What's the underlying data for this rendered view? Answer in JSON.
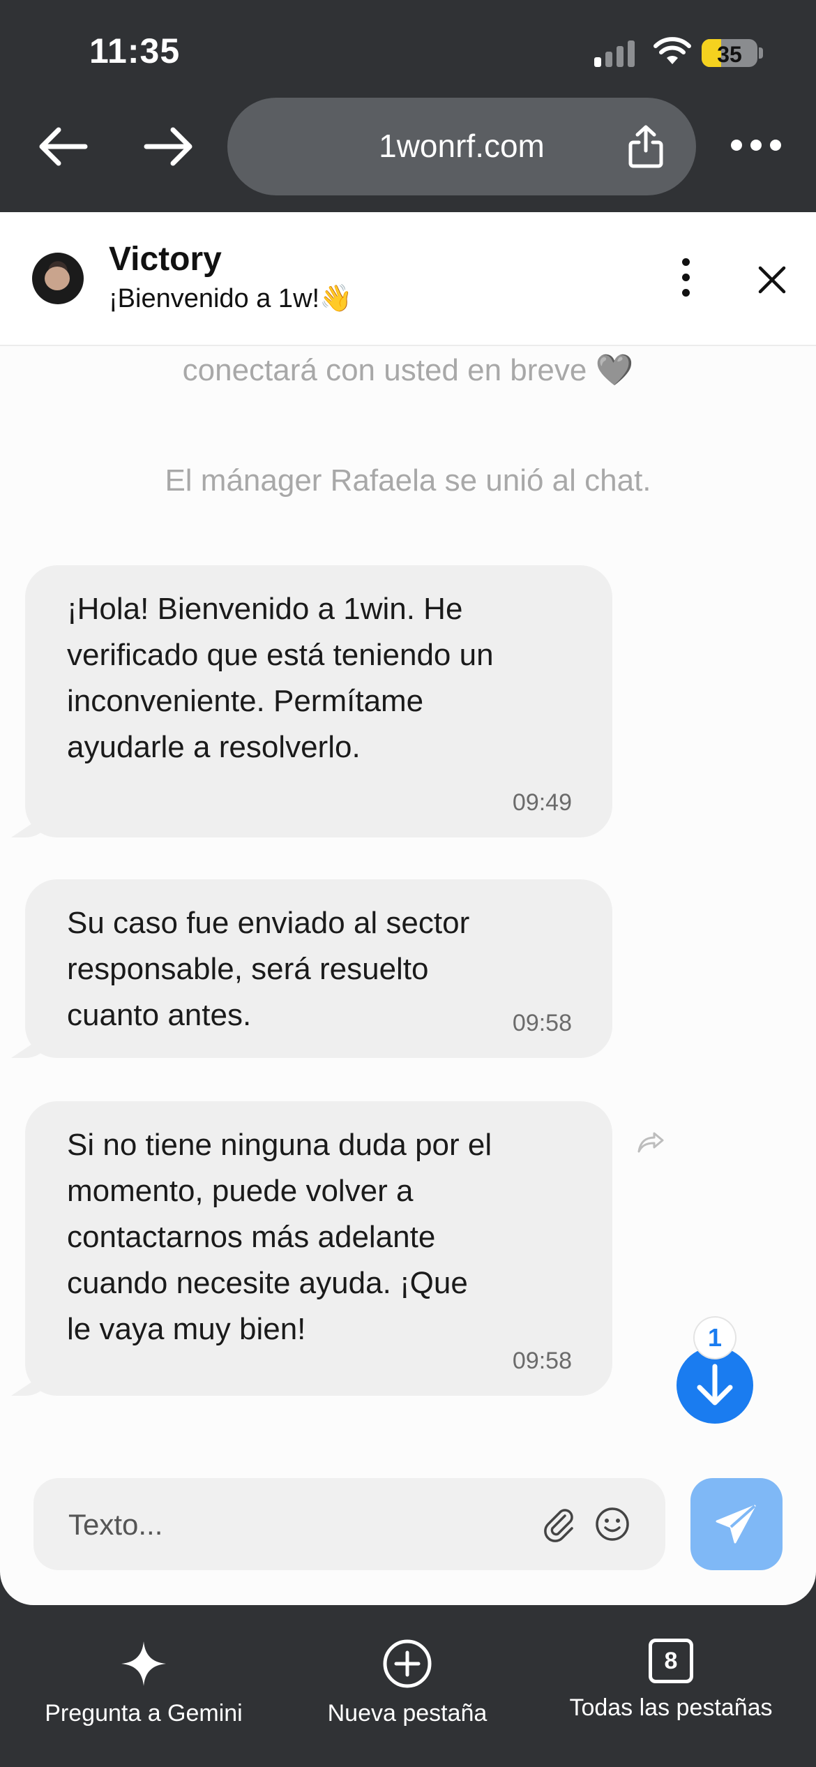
{
  "status_bar": {
    "time": "11:35",
    "battery": "35",
    "battery_level": 0.35
  },
  "browser": {
    "url": "1wonrf.com"
  },
  "chat": {
    "agent_name": "Victory",
    "agent_subtitle": "¡Bienvenido a 1w!👋",
    "system_messages": [
      "conectará con usted en breve 🩶",
      "El mánager Rafaela se unió al chat."
    ],
    "messages": [
      {
        "text": "¡Hola! Bienvenido a 1win. He verificado que está teniendo un inconveniente. Permítame ayudarle a resolverlo.",
        "time": "09:49"
      },
      {
        "text": "Su caso fue enviado al sector responsable, será resuelto cuanto antes.",
        "time": "09:58"
      },
      {
        "text": "Si no tiene ninguna duda por el momento, puede volver a contactarnos más adelante cuando necesite ayuda. ¡Que le vaya muy bien!",
        "time": "09:58"
      }
    ],
    "unread_count": "1",
    "input_placeholder": "Texto...",
    "accent_color": "#1a7cf0"
  },
  "toolbar": {
    "gemini_label": "Pregunta a Gemini",
    "new_tab_label": "Nueva pestaña",
    "all_tabs_label": "Todas las pestañas",
    "tab_count": "8"
  }
}
